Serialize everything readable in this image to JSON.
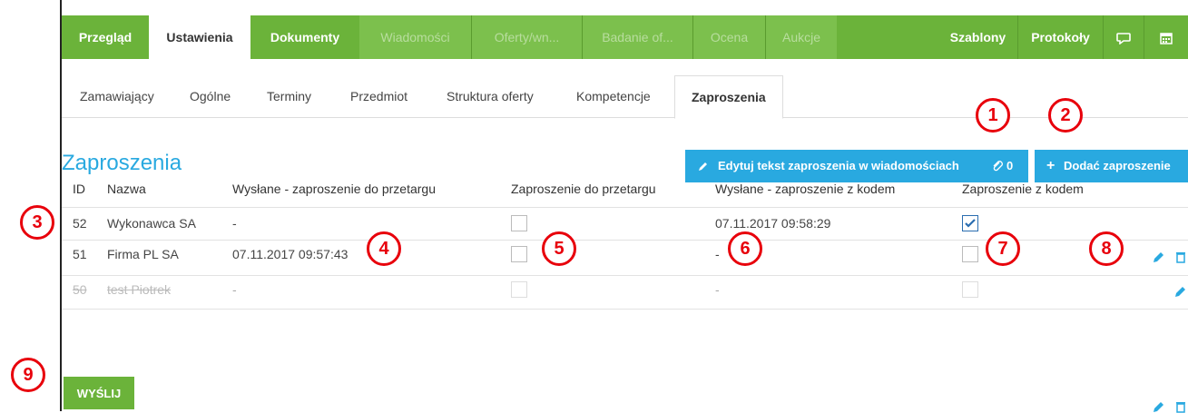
{
  "topnav": {
    "tabs": [
      {
        "label": "Przegląd"
      },
      {
        "label": "Ustawienia"
      },
      {
        "label": "Dokumenty"
      },
      {
        "label": "Wiadomości"
      },
      {
        "label": "Oferty/wn..."
      },
      {
        "label": "Badanie of..."
      },
      {
        "label": "Ocena"
      },
      {
        "label": "Aukcje"
      },
      {
        "label": "Szablony"
      },
      {
        "label": "Protokoły"
      }
    ],
    "accent": "#6bb33a"
  },
  "subnav": {
    "tabs": [
      {
        "label": "Zamawiający"
      },
      {
        "label": "Ogólne"
      },
      {
        "label": "Terminy"
      },
      {
        "label": "Przedmiot"
      },
      {
        "label": "Struktura oferty"
      },
      {
        "label": "Kompetencje"
      },
      {
        "label": "Zaproszenia"
      }
    ]
  },
  "page": {
    "title": "Zaproszenia",
    "edit_button": "Edytuj tekst zaproszenia w wiadomościach",
    "attachment_count": "0",
    "add_button": "Dodać zaproszenie",
    "send_button": "WYŚLIJ"
  },
  "table": {
    "headers": {
      "id": "ID",
      "name": "Nazwa",
      "sent_invite": "Wysłane - zaproszenie do przetargu",
      "invite": "Zaproszenie do przetargu",
      "sent_code": "Wysłane - zaproszenie z kodem",
      "code": "Zaproszenie z kodem"
    },
    "rows": [
      {
        "id": "52",
        "name": "Wykonawca SA",
        "sent_invite": "-",
        "invite_checked": false,
        "sent_code": "07.11.2017 09:58:29",
        "code_checked": true
      },
      {
        "id": "51",
        "name": "Firma PL SA",
        "sent_invite": "07.11.2017 09:57:43",
        "invite_checked": false,
        "sent_code": "-",
        "code_checked": false
      },
      {
        "id": "50",
        "name": "test Piotrek",
        "sent_invite": "-",
        "invite_checked": false,
        "sent_code": "-",
        "code_checked": false,
        "disabled": true
      }
    ]
  },
  "callouts": [
    "1",
    "2",
    "3",
    "4",
    "5",
    "6",
    "7",
    "8",
    "9"
  ],
  "colors": {
    "blue": "#29a9e0",
    "green": "#6bb33a",
    "red": "#e8000b"
  }
}
